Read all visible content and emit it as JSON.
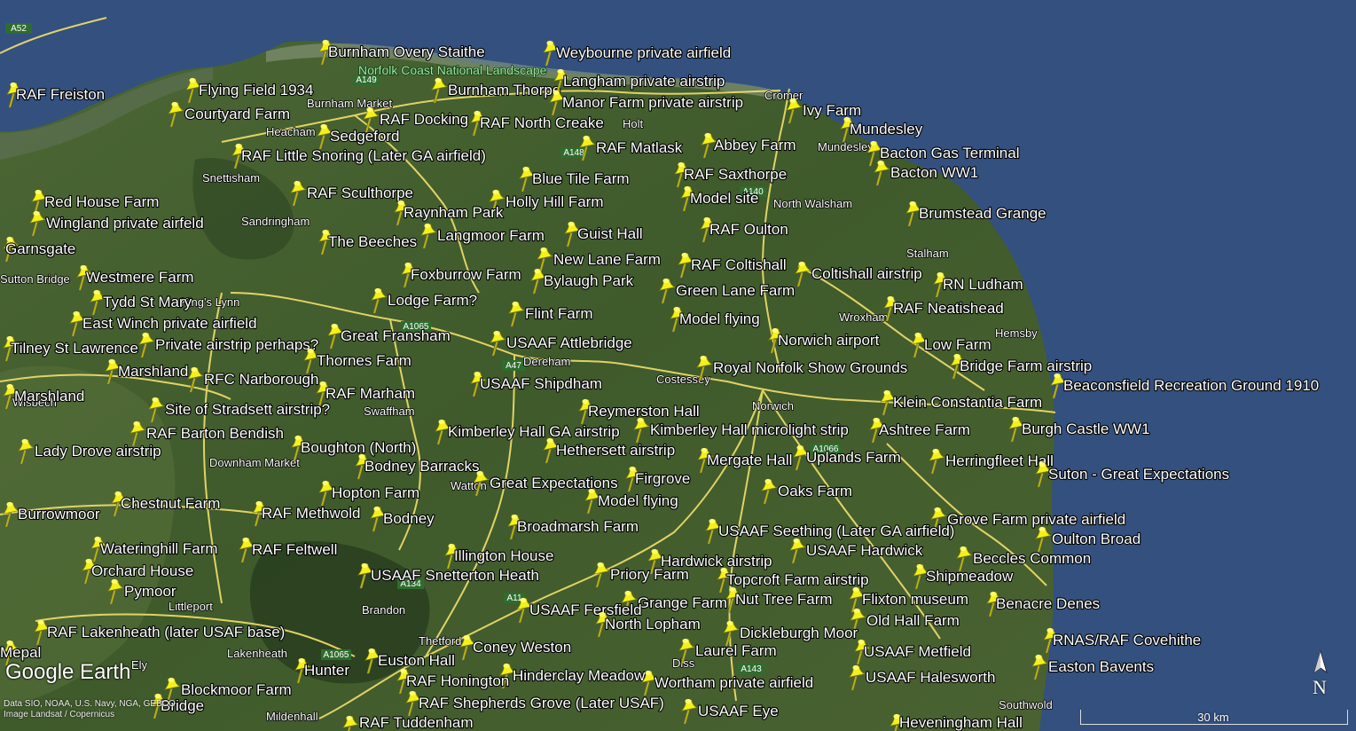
{
  "app": {
    "logo": "Google Earth",
    "credits": [
      "Data SIO, NOAA, U.S. Navy, NGA, GEBCO",
      "Image Landsat / Copernicus"
    ]
  },
  "compass": {
    "label": "N"
  },
  "scale": {
    "label": "30 km"
  },
  "aonb_label": "Norfolk Coast National Landscape",
  "colors": {
    "sea": "#33507f",
    "land": "#3e5a2c",
    "pin": "#f4f01a",
    "road": "#f2e06b"
  },
  "roads": [
    "A52",
    "A149",
    "A148",
    "A140",
    "A1065",
    "A47",
    "A1066",
    "A134",
    "A11",
    "A143",
    "A1065"
  ],
  "places": [
    "Heacham",
    "Burnham Market",
    "Snettisham",
    "Sandringham",
    "Sutton Bridge",
    "King's Lynn",
    "Wisbech",
    "Downham Market",
    "Swaffham",
    "Dereham",
    "Costessey",
    "Norwich",
    "North Walsham",
    "Mundesley",
    "Cromer",
    "Holt",
    "Stalham",
    "Wroxham",
    "Hemsby",
    "Watton",
    "Brandon",
    "Littleport",
    "Lakenheath",
    "Thetford",
    "Mildenhall",
    "Diss",
    "Southwold",
    "Ely"
  ],
  "pins": [
    {
      "label": "RAF Freiston"
    },
    {
      "label": "Flying Field 1934"
    },
    {
      "label": "Courtyard Farm"
    },
    {
      "label": "Burnham Overy Staithe"
    },
    {
      "label": "Weybourne private airfield"
    },
    {
      "label": "Burnham Thorpe"
    },
    {
      "label": "Langham private airstrip"
    },
    {
      "label": "Manor Farm private airstrip"
    },
    {
      "label": "RAF Docking"
    },
    {
      "label": "RAF North Creake"
    },
    {
      "label": "Sedgeford"
    },
    {
      "label": "Ivy Farm"
    },
    {
      "label": "Mundesley"
    },
    {
      "label": "Abbey Farm"
    },
    {
      "label": "RAF Matlask"
    },
    {
      "label": "RAF Little Snoring (Later GA airfield)"
    },
    {
      "label": "Bacton Gas Terminal"
    },
    {
      "label": "Bacton WW1"
    },
    {
      "label": "RAF Saxthorpe"
    },
    {
      "label": "Blue Tile Farm"
    },
    {
      "label": "RAF Sculthorpe"
    },
    {
      "label": "Model site"
    },
    {
      "label": "Red House Farm"
    },
    {
      "label": "Holly Hill Farm"
    },
    {
      "label": "Raynham Park"
    },
    {
      "label": "Brumstead Grange"
    },
    {
      "label": "Wingland private airfeld"
    },
    {
      "label": "RAF Oulton"
    },
    {
      "label": "Guist Hall"
    },
    {
      "label": "Langmoor Farm"
    },
    {
      "label": "The Beeches"
    },
    {
      "label": "Garnsgate"
    },
    {
      "label": "New Lane Farm"
    },
    {
      "label": "Foxburrow Farm"
    },
    {
      "label": "RAF Coltishall"
    },
    {
      "label": "Coltishall airstrip"
    },
    {
      "label": "Westmere Farm"
    },
    {
      "label": "Bylaugh Park"
    },
    {
      "label": "Green Lane Farm"
    },
    {
      "label": "RN Ludham"
    },
    {
      "label": "Tydd St Mary"
    },
    {
      "label": "Lodge Farm?"
    },
    {
      "label": "RAF Neatishead"
    },
    {
      "label": "East Winch private airfield"
    },
    {
      "label": "Flint Farm"
    },
    {
      "label": "Model flying"
    },
    {
      "label": "Great Fransham"
    },
    {
      "label": "USAAF Attlebridge"
    },
    {
      "label": "Norwich airport"
    },
    {
      "label": "Low Farm"
    },
    {
      "label": "Private airstrip perhaps?"
    },
    {
      "label": "Tilney St Lawrence"
    },
    {
      "label": "Thornes Farm"
    },
    {
      "label": "Royal Norfolk Show Grounds"
    },
    {
      "label": "Bridge Farm airstrip"
    },
    {
      "label": "Marshland"
    },
    {
      "label": "RFC Narborough"
    },
    {
      "label": "USAAF Shipdham"
    },
    {
      "label": "Beaconsfield Recreation Ground 1910"
    },
    {
      "label": "Marshland"
    },
    {
      "label": "RAF Marham"
    },
    {
      "label": "Klein Constantia Farm"
    },
    {
      "label": "Site of Stradsett airstrip?"
    },
    {
      "label": "Reymerston Hall"
    },
    {
      "label": "Kimberley Hall GA airstrip"
    },
    {
      "label": "Kimberley Hall microlight strip"
    },
    {
      "label": "Ashtree Farm"
    },
    {
      "label": "Burgh Castle WW1"
    },
    {
      "label": "RAF Barton Bendish"
    },
    {
      "label": "Boughton (North)"
    },
    {
      "label": "Hethersett airstrip"
    },
    {
      "label": "Lady Drove airstrip"
    },
    {
      "label": "Mergate Hall"
    },
    {
      "label": "Uplands Farm"
    },
    {
      "label": "Herringfleet Hall"
    },
    {
      "label": "Bodney Barracks"
    },
    {
      "label": "Suton - Great Expectations"
    },
    {
      "label": "Great Expectations"
    },
    {
      "label": "Firgrove"
    },
    {
      "label": "Hopton Farm"
    },
    {
      "label": "Oaks Farm"
    },
    {
      "label": "Chestnut Farm"
    },
    {
      "label": "Model flying"
    },
    {
      "label": "Burrowmoor"
    },
    {
      "label": "RAF Methwold"
    },
    {
      "label": "Bodney"
    },
    {
      "label": "Grove Farm private airfield"
    },
    {
      "label": "Broadmarsh Farm"
    },
    {
      "label": "USAAF Seething  (Later GA airfield)"
    },
    {
      "label": "Oulton Broad"
    },
    {
      "label": "Wateringhill Farm"
    },
    {
      "label": "RAF Feltwell"
    },
    {
      "label": "USAAF Hardwick"
    },
    {
      "label": "Illington House"
    },
    {
      "label": "Hardwick airstrip"
    },
    {
      "label": "Beccles Common"
    },
    {
      "label": "Orchard House"
    },
    {
      "label": "USAAF Snetterton Heath"
    },
    {
      "label": "Priory Farm"
    },
    {
      "label": "Topcroft Farm airstrip"
    },
    {
      "label": "Shipmeadow"
    },
    {
      "label": "Pymoor"
    },
    {
      "label": "Nut Tree Farm"
    },
    {
      "label": "Flixton museum"
    },
    {
      "label": "Grange Farm"
    },
    {
      "label": "Benacre Denes"
    },
    {
      "label": "USAAF Fersfield"
    },
    {
      "label": "Old Hall Farm"
    },
    {
      "label": "North Lopham"
    },
    {
      "label": "RAF Lakenheath (later USAF base)"
    },
    {
      "label": "Dickleburgh Moor"
    },
    {
      "label": "RNAS/RAF Covehithe"
    },
    {
      "label": "Coney Weston"
    },
    {
      "label": "Laurel Farm"
    },
    {
      "label": "USAAF Metfield"
    },
    {
      "label": "Euston Hall"
    },
    {
      "label": "Easton Bavents"
    },
    {
      "label": "Hunter"
    },
    {
      "label": "Hinderclay Meadow"
    },
    {
      "label": "USAAF Halesworth"
    },
    {
      "label": "RAF Honington"
    },
    {
      "label": "Wortham private airfield"
    },
    {
      "label": "Blockmoor Farm"
    },
    {
      "label": "Bridge"
    },
    {
      "label": "RAF Shepherds Grove (Later USAF)"
    },
    {
      "label": "USAAF Eye"
    },
    {
      "label": "Heveningham Hall"
    },
    {
      "label": "Mepal"
    },
    {
      "label": "RAF Tuddenham"
    }
  ]
}
